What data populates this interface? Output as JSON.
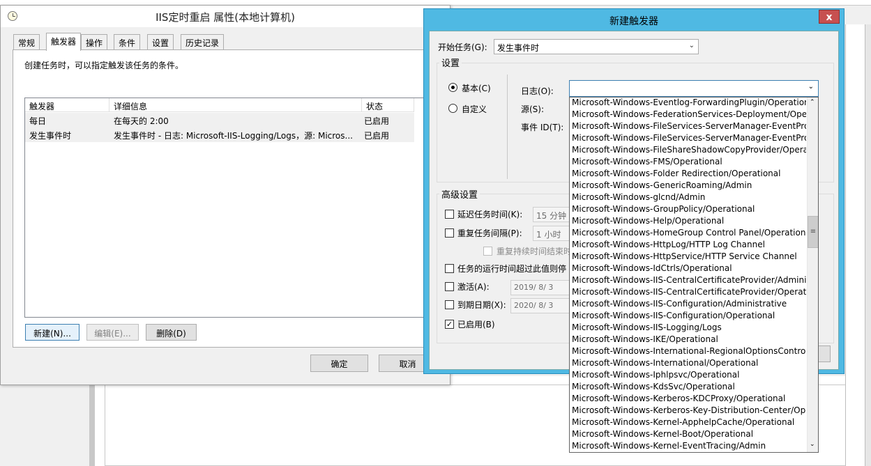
{
  "props_window": {
    "title": "IIS定时重启 属性(本地计算机)",
    "tabs": [
      "常规",
      "触发器",
      "操作",
      "条件",
      "设置",
      "历史记录"
    ],
    "description": "创建任务时，可以指定触发该任务的条件。",
    "table_headers": [
      "触发器",
      "详细信息",
      "状态"
    ],
    "rows": [
      {
        "trigger": "每日",
        "detail": "在每天的 2:00",
        "status": "已启用"
      },
      {
        "trigger": "发生事件时",
        "detail": "发生事件时 - 日志: Microsoft-IIS-Logging/Logs，源: Micros...",
        "status": "已启用"
      }
    ],
    "buttons": {
      "new": "新建(N)...",
      "edit": "编辑(E)...",
      "delete": "删除(D)",
      "ok": "确定",
      "cancel": "取消"
    }
  },
  "trigger_dialog": {
    "title": "新建触发器",
    "close_glyph": "x",
    "begin_label": "开始任务(G):",
    "begin_value": "发生事件时",
    "settings_label": "设置",
    "radio_basic": "基本(C)",
    "radio_custom": "自定义",
    "log_label": "日志(O):",
    "source_label": "源(S):",
    "event_id_label": "事件 ID(T):",
    "advanced_label": "高级设置",
    "delay_label": "延迟任务时间(K):",
    "delay_value": "15 分钟",
    "repeat_label": "重复任务间隔(P):",
    "repeat_value": "1 小时",
    "stop_repeat_label": "重复持续时间结束时",
    "stop_run_label": "任务的运行时间超过此值则停",
    "activate_label": "激活(A):",
    "activate_value": "2019/ 8/ 3",
    "expire_label": "到期日期(X):",
    "expire_value": "2020/ 8/ 3",
    "enabled_label": "已启用(B)"
  },
  "log_options": [
    "Microsoft-Windows-Eventlog-ForwardingPlugin/Operational",
    "Microsoft-Windows-FederationServices-Deployment/Operational",
    "Microsoft-Windows-FileServices-ServerManager-EventProvider",
    "Microsoft-Windows-FileServices-ServerManager-EventProvider",
    "Microsoft-Windows-FileShareShadowCopyProvider/Operational",
    "Microsoft-Windows-FMS/Operational",
    "Microsoft-Windows-Folder Redirection/Operational",
    "Microsoft-Windows-GenericRoaming/Admin",
    "Microsoft-Windows-glcnd/Admin",
    "Microsoft-Windows-GroupPolicy/Operational",
    "Microsoft-Windows-Help/Operational",
    "Microsoft-Windows-HomeGroup Control Panel/Operational",
    "Microsoft-Windows-HttpLog/HTTP Log Channel",
    "Microsoft-Windows-HttpService/HTTP Service Channel",
    "Microsoft-Windows-IdCtrls/Operational",
    "Microsoft-Windows-IIS-CentralCertificateProvider/Administrative",
    "Microsoft-Windows-IIS-CentralCertificateProvider/Operational",
    "Microsoft-Windows-IIS-Configuration/Administrative",
    "Microsoft-Windows-IIS-Configuration/Operational",
    "Microsoft-Windows-IIS-Logging/Logs",
    "Microsoft-Windows-IKE/Operational",
    "Microsoft-Windows-International-RegionalOptionsControlPanel",
    "Microsoft-Windows-International/Operational",
    "Microsoft-Windows-Iphlpsvc/Operational",
    "Microsoft-Windows-KdsSvc/Operational",
    "Microsoft-Windows-Kerberos-KDCProxy/Operational",
    "Microsoft-Windows-Kerberos-Key-Distribution-Center/Operational",
    "Microsoft-Windows-Kernel-ApphelpCache/Operational",
    "Microsoft-Windows-Kernel-Boot/Operational",
    "Microsoft-Windows-Kernel-EventTracing/Admin"
  ]
}
